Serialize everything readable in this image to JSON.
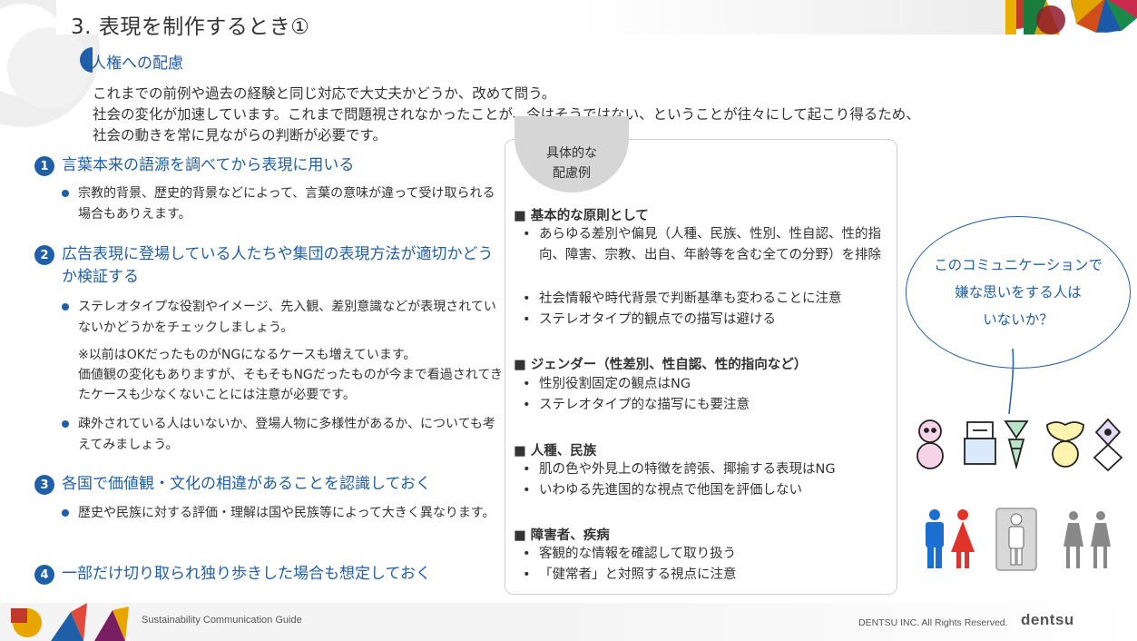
{
  "header": {
    "title": "3. 表現を制作するとき①"
  },
  "section": {
    "label": "人権への配慮"
  },
  "intro": {
    "lines": [
      "これまでの前例や過去の経験と同じ対応で大丈夫かどうか、改めて問う。",
      "社会の変化が加速しています。これまで問題視されなかったことが、今はそうではない、ということが往々にして起こり得るため、",
      "社会の動きを常に見ながらの判断が必要です。"
    ]
  },
  "points": [
    {
      "number": "1",
      "title": "言葉本来の語源を調べてから表現に用いる",
      "bullets": [
        "宗教的背景、歴史的背景などによって、言葉の意味が違って受け取られる場合もありえます。"
      ]
    },
    {
      "number": "2",
      "title": "広告表現に登場している人たちや集団の表現方法が適切かどうか検証する",
      "bullets": [
        "ステレオタイプな役割やイメージ、先入観、差別意識などが表現されていないかどうかをチェックしましょう。",
        "疎外されている人はいないか、登場人物に多様性があるか、についても考えてみましょう。"
      ],
      "note": [
        "※以前はOKだったものがNGになるケースも増えています。",
        "価値観の変化もありますが、そもそもNGだったものが今まで看過されてきたケースも少なくないことには注意が必要です。"
      ]
    },
    {
      "number": "3",
      "title": "各国で価値観・文化の相違があることを認識しておく",
      "bullets": [
        "歴史や民族に対する評価・理解は国や民族等によって大きく異なります。"
      ]
    },
    {
      "number": "4",
      "title": "一部だけ切り取られ独り歩きした場合も想定しておく",
      "bullets": []
    }
  ],
  "examples": {
    "badge": [
      "具体的な",
      "配慮例"
    ],
    "groups": [
      {
        "heading": "■ 基本的な原則として",
        "items": [
          "あらゆる差別や偏見（人種、民族、性別、性自認、性的指向、障害、宗教、出自、年齢等を含む全ての分野）を排除",
          "社会情報や時代背景で判断基準も変わることに注意",
          "ステレオタイプ的観点での描写は避ける"
        ]
      },
      {
        "heading": "■ ジェンダー（性差別、性自認、性的指向など）",
        "items": [
          "性別役割固定の観点はNG",
          "ステレオタイプ的な描写にも要注意"
        ]
      },
      {
        "heading": "■ 人種、民族",
        "items": [
          "肌の色や外見上の特徴を誇張、揶揄する表現はNG",
          "いわゆる先進国的な視点で他国を評価しない"
        ]
      },
      {
        "heading": "■ 障害者、疾病",
        "items": [
          "客観的な情報を確認して取り扱う",
          "「健常者」と対照する視点に注意"
        ]
      }
    ],
    "bullet_mark": "•"
  },
  "bubble": {
    "lines": [
      "このコミュニケーションで",
      "嫌な思いをする人は",
      "いないか？"
    ]
  },
  "footer": {
    "left": "Sustainability Communication Guide",
    "right": "DENTSU INC. All Rights Reserved.",
    "logo": "dentsu"
  },
  "colors": {
    "accent": "#1f5fa8",
    "text": "#333333",
    "badge": "#d6d6d6"
  }
}
